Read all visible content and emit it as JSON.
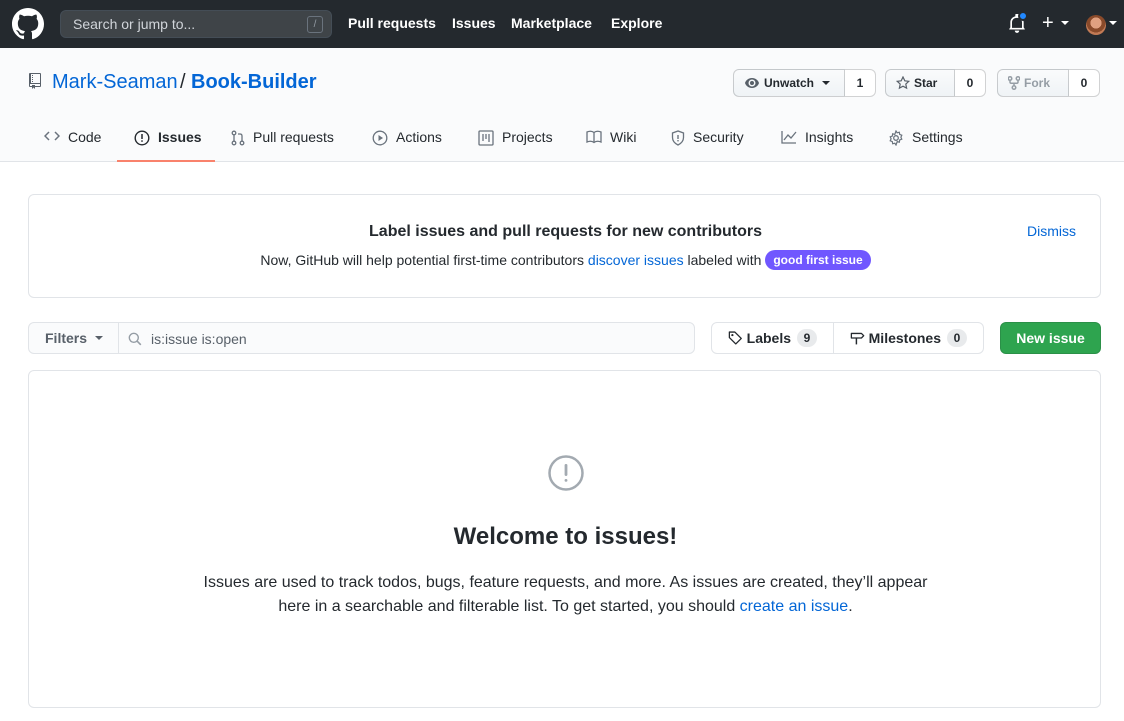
{
  "header": {
    "search_placeholder": "Search or jump to...",
    "search_shortcut": "/",
    "nav": [
      "Pull requests",
      "Issues",
      "Marketplace",
      "Explore"
    ]
  },
  "repo": {
    "owner": "Mark-Seaman",
    "separator": "/",
    "name": "Book-Builder",
    "watch_label": "Unwatch",
    "watch_count": "1",
    "star_label": "Star",
    "star_count": "0",
    "fork_label": "Fork",
    "fork_count": "0"
  },
  "tabs": [
    {
      "label": "Code",
      "icon": "code-icon"
    },
    {
      "label": "Issues",
      "icon": "issue-opened-icon",
      "active": true
    },
    {
      "label": "Pull requests",
      "icon": "git-pull-request-icon"
    },
    {
      "label": "Actions",
      "icon": "play-icon"
    },
    {
      "label": "Projects",
      "icon": "project-icon"
    },
    {
      "label": "Wiki",
      "icon": "book-icon"
    },
    {
      "label": "Security",
      "icon": "shield-icon"
    },
    {
      "label": "Insights",
      "icon": "graph-icon"
    },
    {
      "label": "Settings",
      "icon": "gear-icon"
    }
  ],
  "banner": {
    "title": "Label issues and pull requests for new contributors",
    "text_before": "Now, GitHub will help potential first-time contributors ",
    "link": "discover issues",
    "text_after": " labeled with ",
    "label_badge": "good first issue",
    "dismiss": "Dismiss"
  },
  "filter": {
    "filters_label": "Filters",
    "query": "is:issue is:open",
    "labels_label": "Labels",
    "labels_count": "9",
    "milestones_label": "Milestones",
    "milestones_count": "0",
    "new_issue": "New issue"
  },
  "blankslate": {
    "title": "Welcome to issues!",
    "text_before": "Issues are used to track todos, bugs, feature requests, and more. As issues are created, they’ll appear here in a searchable and filterable list. To get started, you should ",
    "link": "create an issue",
    "text_after": "."
  },
  "colors": {
    "header_bg": "#24292e",
    "link": "#0366d6",
    "active_tab_underline": "#f9826c",
    "primary_button": "#2ea44f",
    "good_first_issue": "#7057ff",
    "notification_dot": "#2188ff"
  }
}
